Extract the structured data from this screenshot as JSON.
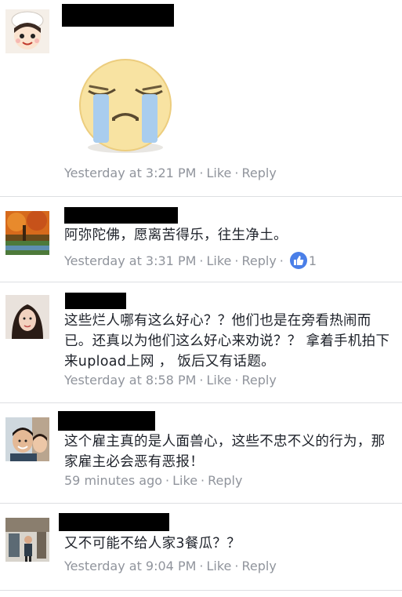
{
  "comments": [
    {
      "text": "",
      "meta": {
        "time": "Yesterday at 3:21 PM",
        "like": "Like",
        "reply": "Reply"
      }
    },
    {
      "text": "阿弥陀佛，愿离苦得乐，往生净土。",
      "meta": {
        "time": "Yesterday at 3:31 PM",
        "like": "Like",
        "reply": "Reply",
        "reactions": "1"
      }
    },
    {
      "text": "这些烂人哪有这么好心？？他们也是在旁看热闹而已。还真以为他们这么好心来劝说？？ 拿着手机拍下来upload上网 ， 饭后又有话题。",
      "meta": {
        "time": "Yesterday at 8:58 PM",
        "like": "Like",
        "reply": "Reply"
      }
    },
    {
      "text": "这个雇主真的是人面兽心，这些不忠不义的行为，那家雇主必会恶有恶报！",
      "meta": {
        "time": "59 minutes ago",
        "like": "Like",
        "reply": "Reply"
      }
    },
    {
      "text": "又不可能不给人家3餐瓜？？",
      "meta": {
        "time": "Yesterday at 9:04 PM",
        "like": "Like",
        "reply": "Reply"
      }
    }
  ],
  "separator": "·",
  "colors": {
    "meta": "#90949c",
    "text": "#1d2129",
    "like_badge": "#4a7fe8",
    "divider": "#dddfe2"
  },
  "icons": [
    "crying-face-sticker",
    "like-reaction-icon"
  ]
}
